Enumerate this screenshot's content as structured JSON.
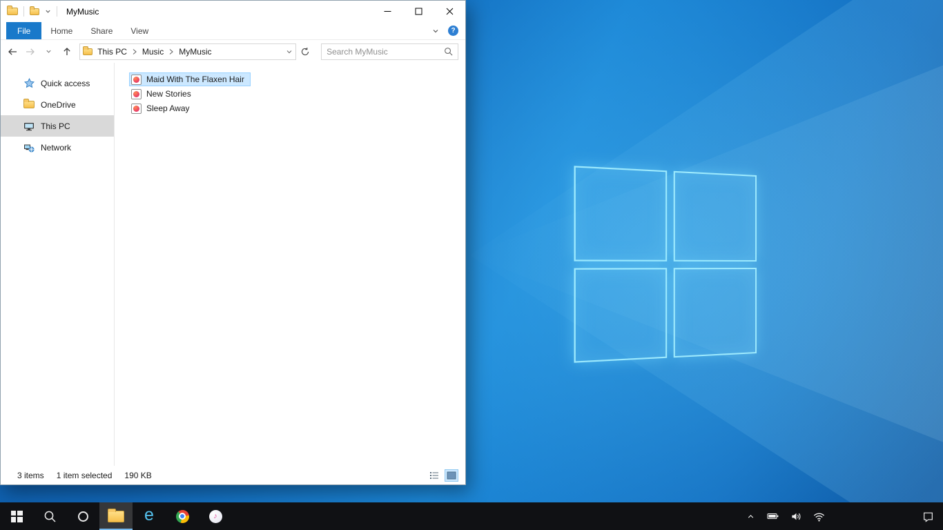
{
  "window": {
    "title": "MyMusic",
    "ribbon": {
      "tabs": [
        {
          "label": "File",
          "active": true
        },
        {
          "label": "Home",
          "active": false
        },
        {
          "label": "Share",
          "active": false
        },
        {
          "label": "View",
          "active": false
        }
      ]
    },
    "address": {
      "crumbs": [
        "This PC",
        "Music",
        "MyMusic"
      ],
      "search_placeholder": "Search MyMusic"
    },
    "nav": {
      "items": [
        {
          "label": "Quick access",
          "selected": false
        },
        {
          "label": "OneDrive",
          "selected": false
        },
        {
          "label": "This PC",
          "selected": true
        },
        {
          "label": "Network",
          "selected": false
        }
      ]
    },
    "files": [
      {
        "name": "Maid With The Flaxen Hair",
        "selected": true
      },
      {
        "name": "New Stories",
        "selected": false
      },
      {
        "name": "Sleep Away",
        "selected": false
      }
    ],
    "statusbar": {
      "count": "3 items",
      "selected": "1 item selected",
      "size": "190 KB"
    }
  },
  "icons": {
    "help_glyph": "?",
    "ie_glyph": "e",
    "itunes_glyph": "♪"
  },
  "colors": {
    "accent": "#1979ca",
    "selection_bg": "#cce8ff",
    "selection_border": "#99d1ff",
    "nav_selected_bg": "#d9d9d9",
    "taskbar_bg": "#101114",
    "active_app_underline": "#76b9ed",
    "desktop_blue": "#1b86d6"
  }
}
